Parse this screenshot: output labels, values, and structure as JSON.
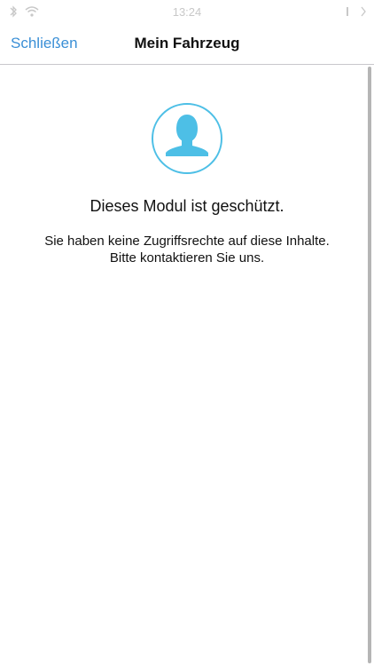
{
  "status_bar": {
    "time": "13:24",
    "left_icons": [
      "bluetooth-icon",
      "wifi-icon"
    ],
    "right_icons": [
      "alarm-icon",
      "battery-icon"
    ]
  },
  "nav": {
    "close_label": "Schließen",
    "title": "Mein Fahrzeug"
  },
  "content": {
    "icon": "person-silhouette-icon",
    "heading": "Dieses Modul ist geschützt.",
    "message_line1": "Sie haben keine Zugriffsrechte auf diese Inhalte.",
    "message_line2": "Bitte kontaktieren Sie uns."
  },
  "colors": {
    "accent": "#3a8fd6",
    "icon": "#4dbfe6",
    "divider": "#c8c7cc"
  }
}
